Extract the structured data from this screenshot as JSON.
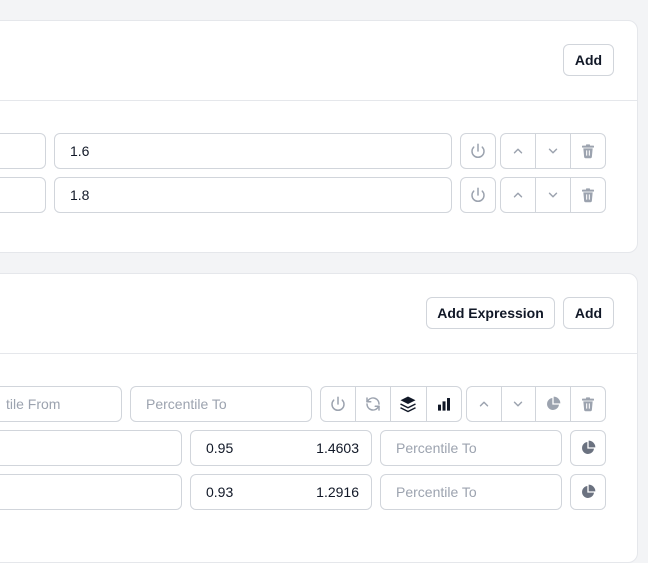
{
  "section1": {
    "add_label": "Add",
    "rows": [
      {
        "value": "1.6"
      },
      {
        "value": "1.8"
      }
    ]
  },
  "section2": {
    "add_expression_label": "Add Expression",
    "add_label": "Add",
    "header_row": {
      "percentile_from_placeholder": "Percentile From",
      "percentile_from_visible": "tile From",
      "percentile_to_placeholder": "Percentile To"
    },
    "rows": [
      {
        "percentile": "0.95",
        "value": "1.4603",
        "percentile_to_placeholder": "Percentile To"
      },
      {
        "percentile": "0.93",
        "value": "1.2916",
        "percentile_to_placeholder": "Percentile To"
      }
    ]
  },
  "icons": {
    "power": "power-icon",
    "up": "chevron-up-icon",
    "down": "chevron-down-icon",
    "trash": "trash-icon",
    "refresh": "refresh-icon",
    "layers": "layers-icon",
    "bars": "bar-chart-icon",
    "pie": "pie-chart-icon"
  },
  "colors": {
    "page_bg": "#f3f4f6",
    "card_bg": "#ffffff",
    "border": "#d1d5db",
    "icon_muted": "#9ca3af",
    "icon_dark": "#111827"
  }
}
